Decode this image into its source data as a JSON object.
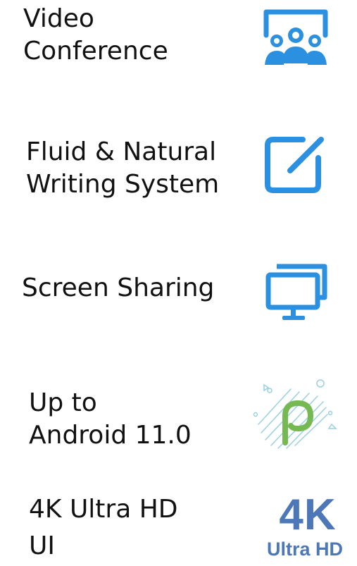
{
  "features": [
    {
      "line1": "Video",
      "line2": "Conference",
      "icon": "video-conference-icon"
    },
    {
      "line1": "Fluid & Natural",
      "line2": "Writing System",
      "icon": "pen-edit-icon"
    },
    {
      "line1": "Screen Sharing",
      "icon": "screen-sharing-icon"
    },
    {
      "line1": "Up to",
      "line2": "Android 11.0",
      "icon": "android-p-logo"
    },
    {
      "line1": "4K Ultra HD",
      "line2": "UI",
      "icon": "4k-ultra-hd-logo"
    }
  ],
  "badge_4k": {
    "big": "4K",
    "small": "Ultra HD"
  },
  "colors": {
    "icon_blue": "#2b90e0",
    "android_green": "#76b852",
    "badge_blue": "#4d77b6",
    "text": "#111111"
  }
}
